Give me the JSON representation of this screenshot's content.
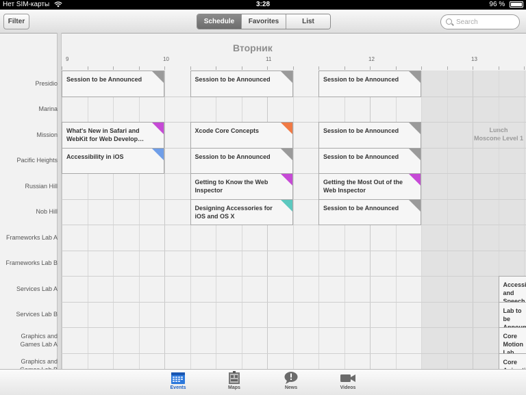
{
  "statusbar": {
    "carrier": "Нет SIM-карты",
    "time": "3:28",
    "battery": "96 %"
  },
  "navbar": {
    "filter_label": "Filter",
    "segments": [
      "Schedule",
      "Favorites",
      "List"
    ],
    "active_segment": "Schedule",
    "search_placeholder": "Search",
    "search_value": ""
  },
  "schedule": {
    "day_title": "Вторник",
    "hours": [
      "9",
      "10",
      "11",
      "12",
      "13"
    ],
    "rooms": [
      "Presidio",
      "Marina",
      "Mission",
      "Pacific Heights",
      "Russian Hill",
      "Nob Hill",
      "Frameworks Lab A",
      "Frameworks Lab B",
      "Services Lab A",
      "Services Lab B",
      "Graphics and Games Lab A",
      "Graphics and Games Lab B"
    ],
    "lunch": {
      "title": "Lunch",
      "location": "Moscone Level 1"
    },
    "sessions": [
      {
        "room": "Presidio",
        "title": "Session to be Announced",
        "start": 9,
        "end": 10,
        "tag_color": "#9a9a9a"
      },
      {
        "room": "Presidio",
        "title": "Session to be Announced",
        "start": 10.25,
        "end": 11.25,
        "tag_color": "#9a9a9a"
      },
      {
        "room": "Presidio",
        "title": "Session to be Announced",
        "start": 11.5,
        "end": 12.5,
        "tag_color": "#9a9a9a"
      },
      {
        "room": "Mission",
        "title": "What's New in Safari and WebKit for Web Develop…",
        "start": 9,
        "end": 10,
        "tag_color": "#c64ad6"
      },
      {
        "room": "Mission",
        "title": "Xcode Core Concepts",
        "start": 10.25,
        "end": 11.25,
        "tag_color": "#f07a45"
      },
      {
        "room": "Mission",
        "title": "Session to be Announced",
        "start": 11.5,
        "end": 12.5,
        "tag_color": "#9a9a9a"
      },
      {
        "room": "Pacific Heights",
        "title": "Accessibility in iOS",
        "start": 9,
        "end": 10,
        "tag_color": "#6f9ee8"
      },
      {
        "room": "Pacific Heights",
        "title": "Session to be Announced",
        "start": 10.25,
        "end": 11.25,
        "tag_color": "#9a9a9a"
      },
      {
        "room": "Pacific Heights",
        "title": "Session to be Announced",
        "start": 11.5,
        "end": 12.5,
        "tag_color": "#9a9a9a"
      },
      {
        "room": "Russian Hill",
        "title": "Getting to Know the Web Inspector",
        "start": 10.25,
        "end": 11.25,
        "tag_color": "#c64ad6"
      },
      {
        "room": "Russian Hill",
        "title": "Getting the Most Out of the Web Inspector",
        "start": 11.5,
        "end": 12.5,
        "tag_color": "#c64ad6"
      },
      {
        "room": "Nob Hill",
        "title": "Designing Accessories for iOS and OS X",
        "start": 10.25,
        "end": 11.25,
        "tag_color": "#5cc8bf"
      },
      {
        "room": "Nob Hill",
        "title": "Session to be Announced",
        "start": 11.5,
        "end": 12.5,
        "tag_color": "#9a9a9a"
      },
      {
        "room": "Services Lab A",
        "title": "Accessibility and Speech",
        "start": 13.25,
        "end": 15,
        "tag_color": ""
      },
      {
        "room": "Services Lab B",
        "title": "Lab to be Announced",
        "start": 13.25,
        "end": 15,
        "tag_color": ""
      },
      {
        "room": "Graphics and Games Lab A",
        "title": "Core Motion Lab",
        "start": 13.25,
        "end": 15,
        "tag_color": ""
      },
      {
        "room": "Graphics and Games Lab B",
        "title": "Core Animation and Quartz",
        "start": 13.25,
        "end": 15,
        "tag_color": ""
      }
    ]
  },
  "tabbar": {
    "tabs": [
      {
        "label": "Events",
        "icon": "calendar-icon",
        "active": true
      },
      {
        "label": "Maps",
        "icon": "map-icon",
        "active": false
      },
      {
        "label": "News",
        "icon": "news-icon",
        "active": false
      },
      {
        "label": "Videos",
        "icon": "video-camera-icon",
        "active": false
      }
    ]
  }
}
